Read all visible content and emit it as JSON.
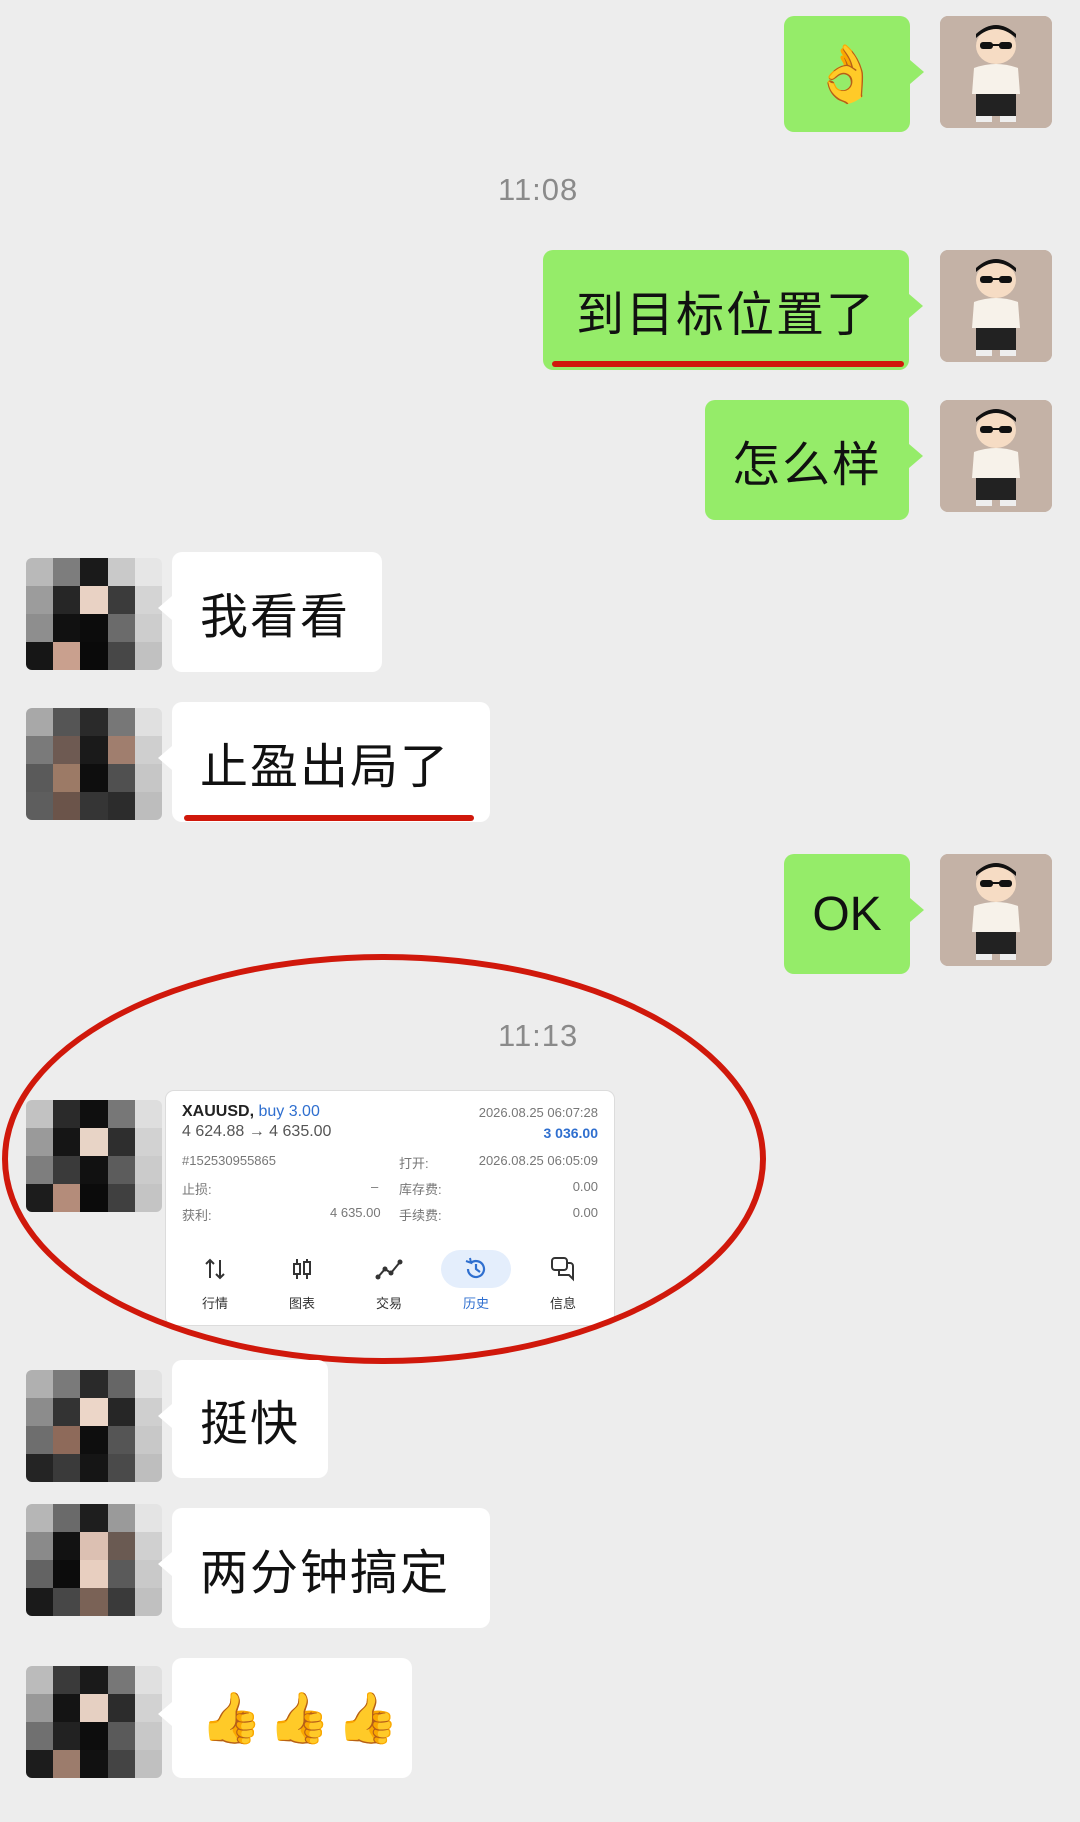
{
  "messages": {
    "m1_emoji": "👌",
    "time_1": "11:08",
    "m2": "到目标位置了",
    "m3": "怎么样",
    "m4": "我看看",
    "m5": "止盈出局了",
    "m6": "OK",
    "time_2": "11:13",
    "m8": "挺快",
    "m9": "两分钟搞定",
    "m10_emoji": "👍👍👍"
  },
  "trade_card": {
    "symbol": "XAUUSD,",
    "side": "buy 3.00",
    "price_move": "4 624.88 → 4 635.00",
    "close_time": "2026.08.25 06:07:28",
    "profit": "3 036.00",
    "order_id": "#152530955865",
    "open_label": "打开:",
    "open_time": "2026.08.25 06:05:09",
    "sl_label": "止损:",
    "sl_value": "–",
    "swap_label": "库存费:",
    "swap_value": "0.00",
    "tp_label": "获利:",
    "tp_value": "4 635.00",
    "commission_label": "手续费:",
    "commission_value": "0.00",
    "tabs": [
      {
        "label": "行情",
        "icon": "arrows-updown-icon"
      },
      {
        "label": "图表",
        "icon": "candlestick-icon"
      },
      {
        "label": "交易",
        "icon": "trend-line-icon"
      },
      {
        "label": "历史",
        "icon": "history-clock-icon",
        "active": true
      },
      {
        "label": "信息",
        "icon": "chat-bubbles-icon"
      }
    ]
  },
  "colors": {
    "sent_bubble": "#95ec69",
    "recv_bubble": "#ffffff",
    "background": "#ededed",
    "annotation_red": "#d0180b",
    "accent_blue": "#2f6fcf"
  }
}
